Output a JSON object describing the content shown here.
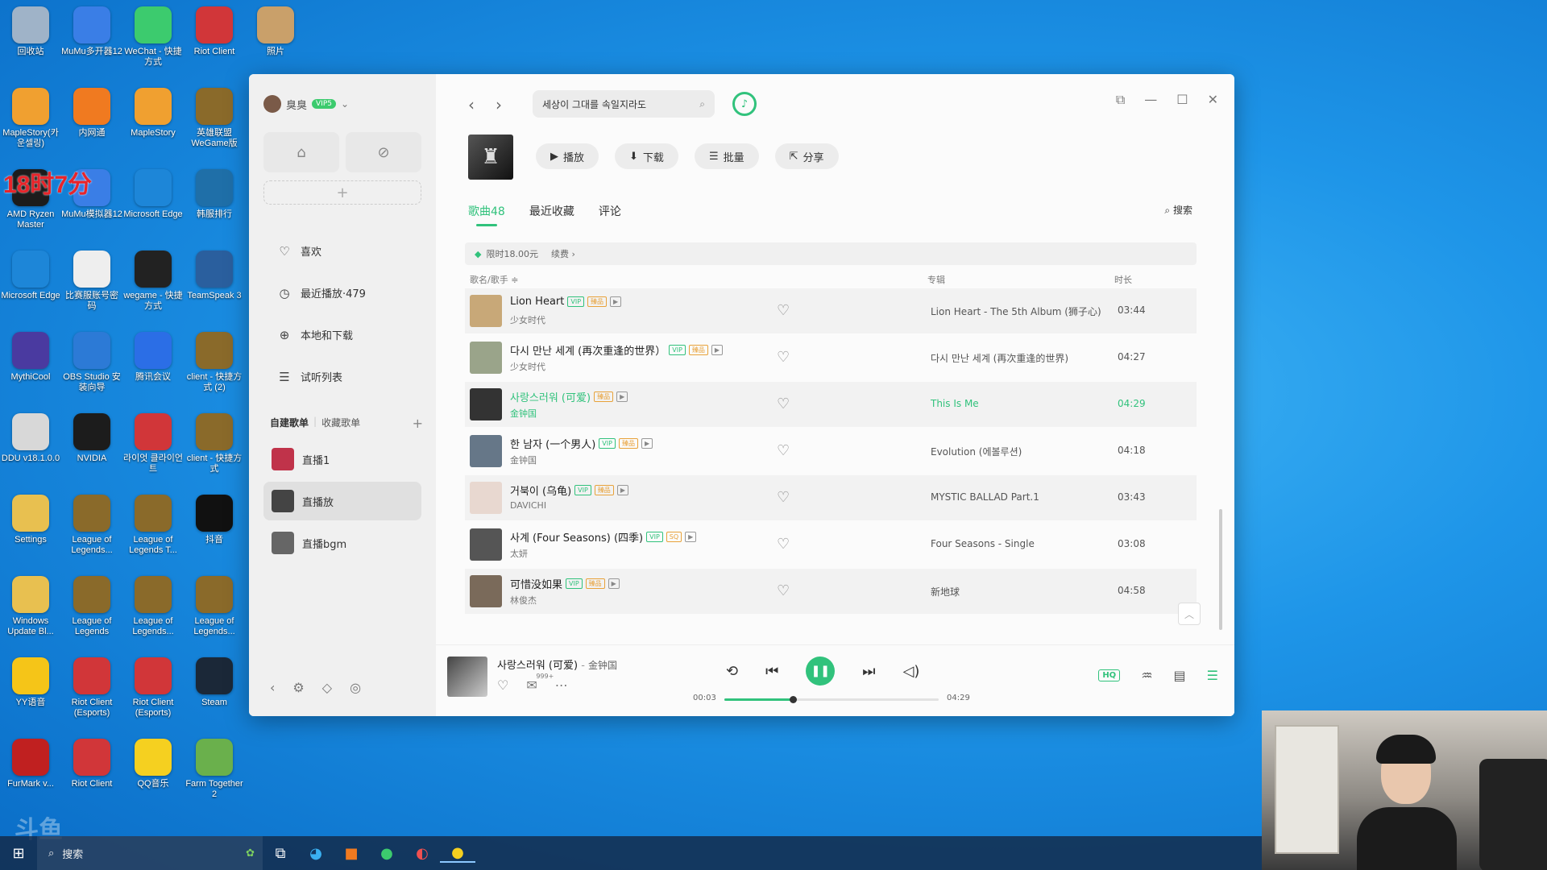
{
  "desktop": {
    "overlay_text": "18时7分",
    "watermark": "斗鱼",
    "icons": [
      {
        "label": "回收站",
        "color": "#9fb3c8"
      },
      {
        "label": "MuMu多开器12",
        "color": "#3a7ee6"
      },
      {
        "label": "WeChat - 快捷方式",
        "color": "#3ccb6e"
      },
      {
        "label": "Riot Client",
        "color": "#d13639"
      },
      {
        "label": "照片",
        "color": "#c9a06a"
      },
      {
        "label": "MapleStory(카운셀링)",
        "color": "#f0a030"
      },
      {
        "label": "内网通",
        "color": "#f07a20"
      },
      {
        "label": "MapleStory",
        "color": "#f0a030"
      },
      {
        "label": "英雄联盟WeGame版",
        "color": "#8a6a2a"
      },
      {
        "label": "AMD Ryzen Master",
        "color": "#1c1c1c"
      },
      {
        "label": "MuMu模拟器12",
        "color": "#3a7ee6"
      },
      {
        "label": "Microsoft Edge",
        "color": "#1d86d8"
      },
      {
        "label": "韩服排行",
        "color": "#1f6fa8"
      },
      {
        "label": "Microsoft Edge",
        "color": "#1d86d8"
      },
      {
        "label": "比赛服账号密码",
        "color": "#eeeeee"
      },
      {
        "label": "wegame - 快捷方式",
        "color": "#222222"
      },
      {
        "label": "TeamSpeak 3",
        "color": "#2a5f9e"
      },
      {
        "label": "MythiCool",
        "color": "#4a3aa0"
      },
      {
        "label": "OBS Studio 安装向导",
        "color": "#2c7ad6"
      },
      {
        "label": "腾讯会议",
        "color": "#2b6ee6"
      },
      {
        "label": "client - 快捷方式 (2)",
        "color": "#8a6a2a"
      },
      {
        "label": "DDU v18.1.0.0",
        "color": "#d8d8d8"
      },
      {
        "label": "NVIDIA",
        "color": "#1c1c1c"
      },
      {
        "label": "라이엇 클라이언트",
        "color": "#d13639"
      },
      {
        "label": "client - 快捷方式",
        "color": "#8a6a2a"
      },
      {
        "label": "Settings",
        "color": "#e8c050"
      },
      {
        "label": "League of Legends...",
        "color": "#8a6a2a"
      },
      {
        "label": "League of Legends T...",
        "color": "#8a6a2a"
      },
      {
        "label": "抖音",
        "color": "#111111"
      },
      {
        "label": "Windows Update Bl...",
        "color": "#e8c050"
      },
      {
        "label": "League of Legends",
        "color": "#8a6a2a"
      },
      {
        "label": "League of Legends...",
        "color": "#8a6a2a"
      },
      {
        "label": "League of Legends...",
        "color": "#8a6a2a"
      },
      {
        "label": "YY语音",
        "color": "#f5c518"
      },
      {
        "label": "Riot Client (Esports)",
        "color": "#d13639"
      },
      {
        "label": "Riot Client (Esports)",
        "color": "#d13639"
      },
      {
        "label": "Steam",
        "color": "#1b2838"
      },
      {
        "label": "FurMark v...",
        "color": "#c02020"
      },
      {
        "label": "Riot Client",
        "color": "#d13639"
      },
      {
        "label": "QQ音乐",
        "color": "#f5d020"
      },
      {
        "label": "Farm Together 2",
        "color": "#6ab04c"
      }
    ]
  },
  "app": {
    "user": {
      "name": "臭臭",
      "vip": "VIP5"
    },
    "sidebar": {
      "nav": [
        {
          "label": "喜欢",
          "icon": "heart-icon",
          "glyph": "♡"
        },
        {
          "label": "最近播放·479",
          "icon": "clock-icon",
          "glyph": "◷"
        },
        {
          "label": "本地和下载",
          "icon": "download-icon",
          "glyph": "⊕"
        },
        {
          "label": "试听列表",
          "icon": "list-icon",
          "glyph": "☰"
        }
      ],
      "playlist_tabs": [
        "自建歌单",
        "收藏歌单"
      ],
      "playlists": [
        {
          "label": "直播1",
          "color": "#c0334a"
        },
        {
          "label": "直播放",
          "color": "#444444"
        },
        {
          "label": "直播bgm",
          "color": "#666666"
        }
      ]
    },
    "search": {
      "value": "세상이 그대를 속일지라도"
    },
    "actions": {
      "play": "播放",
      "download": "下载",
      "batch": "批量",
      "share": "分享"
    },
    "tabs": {
      "songs": "歌曲48",
      "recent": "最近收藏",
      "comments": "评论",
      "search": "搜索"
    },
    "promo": {
      "price": "限时18.00元",
      "renew": "续费 ›"
    },
    "columns": {
      "title": "歌名/歌手 ≑",
      "album": "专辑",
      "duration": "时长"
    },
    "songs": [
      {
        "title": "Lion Heart",
        "artist": "少女时代",
        "album": "Lion Heart - The 5th Album (狮子心)",
        "duration": "03:44",
        "badges": [
          "VIP",
          "HQ",
          "MV"
        ],
        "color": "#c8a878",
        "playing": false
      },
      {
        "title": "다시 만난 세계 (再次重逢的世界）",
        "artist": "少女时代",
        "album": "다시 만난 세계 (再次重逢的世界)",
        "duration": "04:27",
        "badges": [
          "VIP",
          "HQ",
          "MV"
        ],
        "color": "#9aa48a",
        "playing": false
      },
      {
        "title": "사랑스러워 (可爱)",
        "artist": "金钟国",
        "album": "This Is Me",
        "duration": "04:29",
        "badges": [
          "HQ",
          "MV"
        ],
        "color": "#333333",
        "playing": true
      },
      {
        "title": "한 남자 (一个男人)",
        "artist": "金钟国",
        "album": "Evolution (에볼루션)",
        "duration": "04:18",
        "badges": [
          "VIP",
          "HQ",
          "MV"
        ],
        "color": "#667788",
        "playing": false
      },
      {
        "title": "거북이 (乌龟)",
        "artist": "DAVICHI",
        "album": "MYSTIC BALLAD Part.1",
        "duration": "03:43",
        "badges": [
          "VIP",
          "HQ",
          "MV"
        ],
        "color": "#e8d8d0",
        "playing": false
      },
      {
        "title": "사계 (Four Seasons) (四季)",
        "artist": "太妍",
        "album": "Four Seasons - Single",
        "duration": "03:08",
        "badges": [
          "VIP",
          "SQ",
          "MV"
        ],
        "color": "#555555",
        "playing": false
      },
      {
        "title": "可惜没如果",
        "artist": "林俊杰",
        "album": "新地球",
        "duration": "04:58",
        "badges": [
          "VIP",
          "HQ",
          "MV"
        ],
        "color": "#7a6a5a",
        "playing": false
      }
    ],
    "player": {
      "title": "사랑스러워 (可爱)",
      "artist": "金钟国",
      "separator": " - ",
      "current": "00:03",
      "total": "04:29",
      "progress": 0.32,
      "comments": "999+",
      "quality": "HQ"
    }
  },
  "taskbar": {
    "search_placeholder": "搜索"
  },
  "colors": {
    "accent": "#31c27c"
  }
}
